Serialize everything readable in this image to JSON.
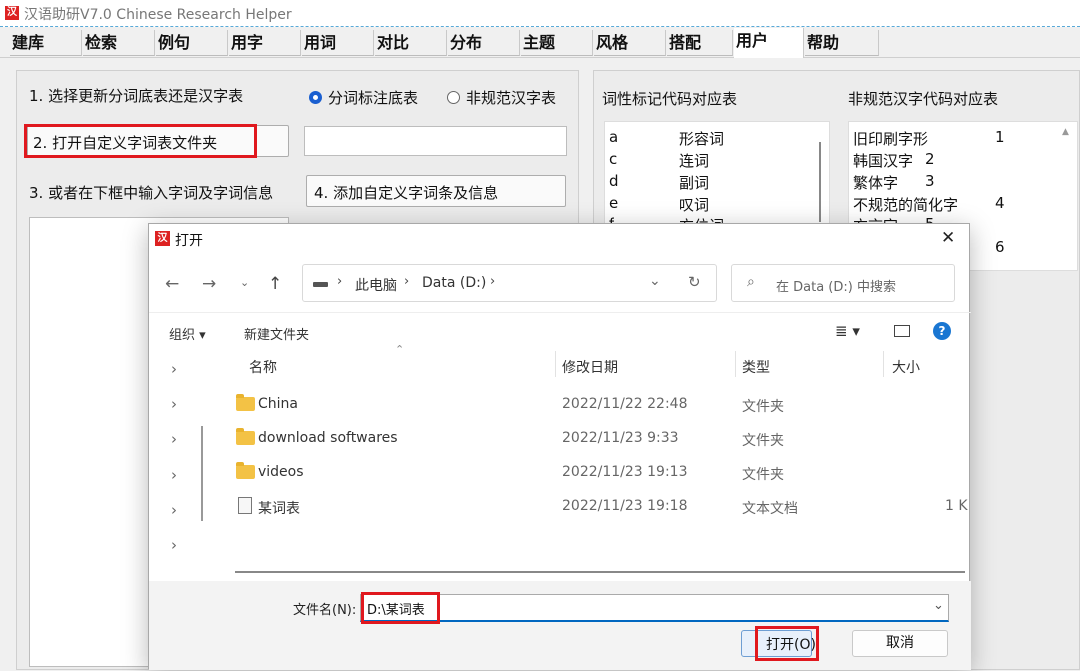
{
  "app": {
    "title": "汉语助研V7.0  Chinese Research Helper",
    "icon_text": "汉"
  },
  "menu": [
    "建库",
    "检索",
    "例句",
    "用字",
    "用词",
    "对比",
    "分布",
    "主题",
    "风格",
    "搭配",
    "用户",
    "帮助"
  ],
  "left": {
    "step1": "1. 选择更新分词底表还是汉字表",
    "radio1": "分词标注底表",
    "radio2": "非规范汉字表",
    "step2": "2. 打开自定义字词表文件夹",
    "step3": "3. 或者在下框中输入字词及字词信息",
    "step4": "4. 添加自定义字词条及信息"
  },
  "pos_table": {
    "title": "词性标记代码对应表",
    "rows": [
      {
        "code": "a",
        "name": "形容词"
      },
      {
        "code": "c",
        "name": "连词"
      },
      {
        "code": "d",
        "name": "副词"
      },
      {
        "code": "e",
        "name": "叹词"
      },
      {
        "code": "f",
        "name": "方位词"
      }
    ]
  },
  "nonstd_table": {
    "title": "非规范汉字代码对应表",
    "rows": [
      {
        "name": "旧印刷字形",
        "code": "1"
      },
      {
        "name": "韩国汉字",
        "code": "2"
      },
      {
        "name": "繁体字",
        "code": "3"
      },
      {
        "name": "不规范的简化字",
        "code": "4"
      },
      {
        "name": "方言字",
        "code": "5"
      },
      {
        "name": "",
        "code": "6"
      }
    ]
  },
  "dialog": {
    "icon_text": "汉",
    "title": "打开",
    "close": "✕",
    "breadcrumb": [
      "此电脑",
      "Data (D:)"
    ],
    "search_placeholder": "在 Data (D:) 中搜索",
    "organize": "组织 ▾",
    "new_folder": "新建文件夹",
    "columns": {
      "name": "名称",
      "date": "修改日期",
      "type": "类型",
      "size": "大小"
    },
    "files": [
      {
        "name": "China",
        "date": "2022/11/22 22:48",
        "type": "文件夹",
        "size": "",
        "kind": "folder"
      },
      {
        "name": "download softwares",
        "date": "2022/11/23 9:33",
        "type": "文件夹",
        "size": "",
        "kind": "folder"
      },
      {
        "name": "videos",
        "date": "2022/11/23 19:13",
        "type": "文件夹",
        "size": "",
        "kind": "folder"
      },
      {
        "name": "某词表",
        "date": "2022/11/23 19:18",
        "type": "文本文档",
        "size": "1 K",
        "kind": "file"
      }
    ],
    "filename_label": "文件名(N):",
    "filename_value": "D:\\某词表",
    "open_btn": "打开(O)",
    "cancel_btn": "取消"
  }
}
